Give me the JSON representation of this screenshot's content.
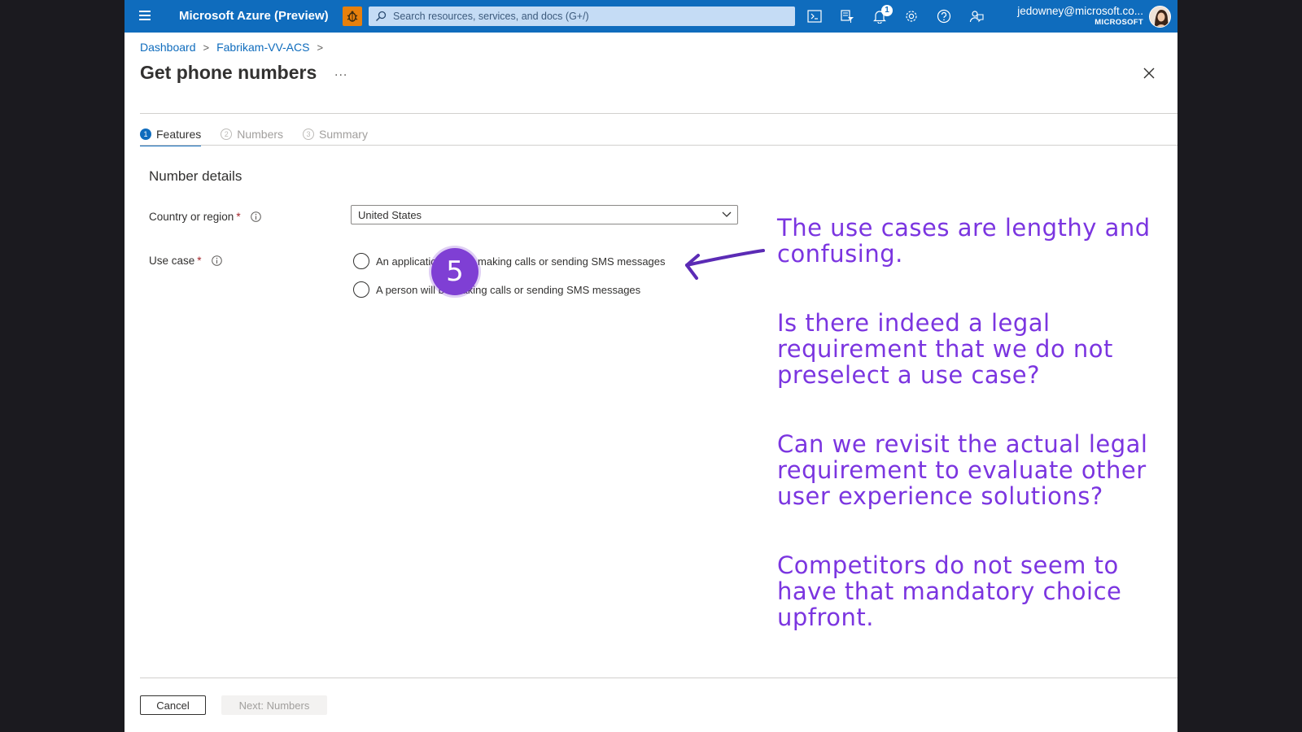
{
  "topbar": {
    "brand": "Microsoft Azure (Preview)",
    "search_placeholder": "Search resources, services, and docs (G+/)",
    "notification_count": "1",
    "account_email": "jedowney@microsoft.co...",
    "account_org": "MICROSOFT",
    "icons": [
      "menu-icon",
      "bug-icon",
      "search-icon",
      "cloud-shell-icon",
      "directory-filter-icon",
      "bell-icon",
      "gear-icon",
      "help-icon",
      "feedback-icon"
    ],
    "accent_color": "#0f6cbd"
  },
  "breadcrumb": {
    "items": [
      "Dashboard",
      "Fabrikam-VV-ACS"
    ]
  },
  "page": {
    "title": "Get phone numbers",
    "more_label": "..."
  },
  "tabs": [
    {
      "num": "1",
      "label": "Features",
      "active": true
    },
    {
      "num": "2",
      "label": "Numbers",
      "active": false
    },
    {
      "num": "3",
      "label": "Summary",
      "active": false
    }
  ],
  "form": {
    "section_title": "Number details",
    "country_label": "Country or region",
    "country_value": "United States",
    "use_case_label": "Use case",
    "required_mark": "*",
    "use_case_options": [
      "An application will be making calls or sending SMS messages",
      "A person will be making calls or sending SMS messages"
    ]
  },
  "annotation": {
    "step_number": "5",
    "color": "#7b35e0",
    "notes": [
      "The use cases are lengthy and confusing.",
      "Is there indeed a legal requirement that we do not preselect a use case?",
      "Can we revisit the actual legal requirement to evaluate other user experience solutions?",
      "Competitors do not seem to have that mandatory choice upfront."
    ]
  },
  "footer": {
    "cancel_label": "Cancel",
    "next_label": "Next: Numbers"
  }
}
